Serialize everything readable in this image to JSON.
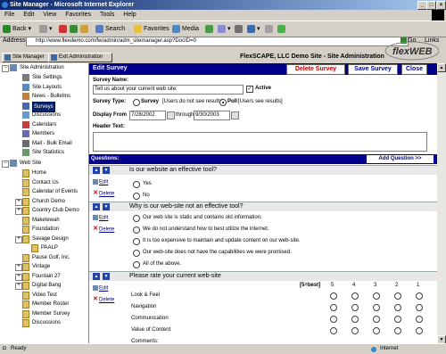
{
  "window": {
    "title": "Site Manager - Microsoft Internet Explorer"
  },
  "menu": [
    "File",
    "Edit",
    "View",
    "Favorites",
    "Tools",
    "Help"
  ],
  "toolbar": {
    "back": "Back",
    "search": "Search",
    "favorites": "Favorites",
    "media": "Media"
  },
  "address": {
    "label": "Address",
    "url": "http://www.flexdemo.com/fw/admin/adm_sitemanager.asp?DocID=0",
    "go": "Go",
    "links": "Links"
  },
  "tabs": {
    "site_manager": "Site Manager",
    "exit": "Exit Administration"
  },
  "site_info": "FlexSCAPE, LLC Demo Site - Site Administration",
  "logo": "flexWEB",
  "tree": {
    "site_admin": "Site Administration",
    "admin_items": [
      "Site Settings",
      "Site Layouts",
      "News - Bulletins",
      "Surveys",
      "Discussions",
      "Calendars",
      "Members",
      "Mail - Bulk Email",
      "Site Statistics"
    ],
    "web_site": "Web Site",
    "web_items": [
      "Home",
      "Contact Us",
      "Calendar of Events",
      "Church Demo",
      "Country Club Demo",
      "Maketewah",
      "Foundation",
      "Savage Design",
      "PAALP",
      "Pause Golf, Inc.",
      "Vintage",
      "Fountain 27",
      "Digital Bang",
      "Video Test",
      "Member Roster",
      "Member Survey",
      "Discussions"
    ]
  },
  "editor": {
    "title": "Edit Survey",
    "delete_btn": "Delete Survey",
    "save_btn": "Save Survey",
    "close_btn": "Close",
    "name_label": "Survey Name:",
    "name_value": "Tell us about your current web site:",
    "active_label": "Active",
    "type_label": "Survey Type:",
    "type_survey": "Survey",
    "type_survey_note": "[Users do not see results]",
    "type_poll": "Poll",
    "type_poll_note": "[Users see results]",
    "display_label": "Display From",
    "from_date": "7/28/2002",
    "through_label": "through",
    "to_date": "9/30/2003",
    "header_label": "Header Text:",
    "questions_label": "Questions:",
    "add_question": "Add Question >>",
    "edit": "Edit",
    "delete": "Delete"
  },
  "questions": [
    {
      "text": "Is our website an effective tool?",
      "options": [
        "Yes",
        "No"
      ]
    },
    {
      "text": "Why is our web-site not an effective tool?",
      "options": [
        "Our web site is static and contains old information.",
        "We do not understand how to best utilize the internet.",
        "It is too expensive to maintain and update content on our web-site.",
        "Our web-site does not have the capabilities we were promised.",
        "All of the above."
      ]
    },
    {
      "text": "Please rate your current web-site",
      "scale_label": "[5=best]",
      "scale": [
        "5",
        "4",
        "3",
        "2",
        "1"
      ],
      "rows": [
        "Look & Feel",
        "Navigation",
        "Communication",
        "Value of Content",
        "Comments:"
      ]
    }
  ],
  "status": {
    "left": "Ready",
    "zone": "Internet"
  }
}
